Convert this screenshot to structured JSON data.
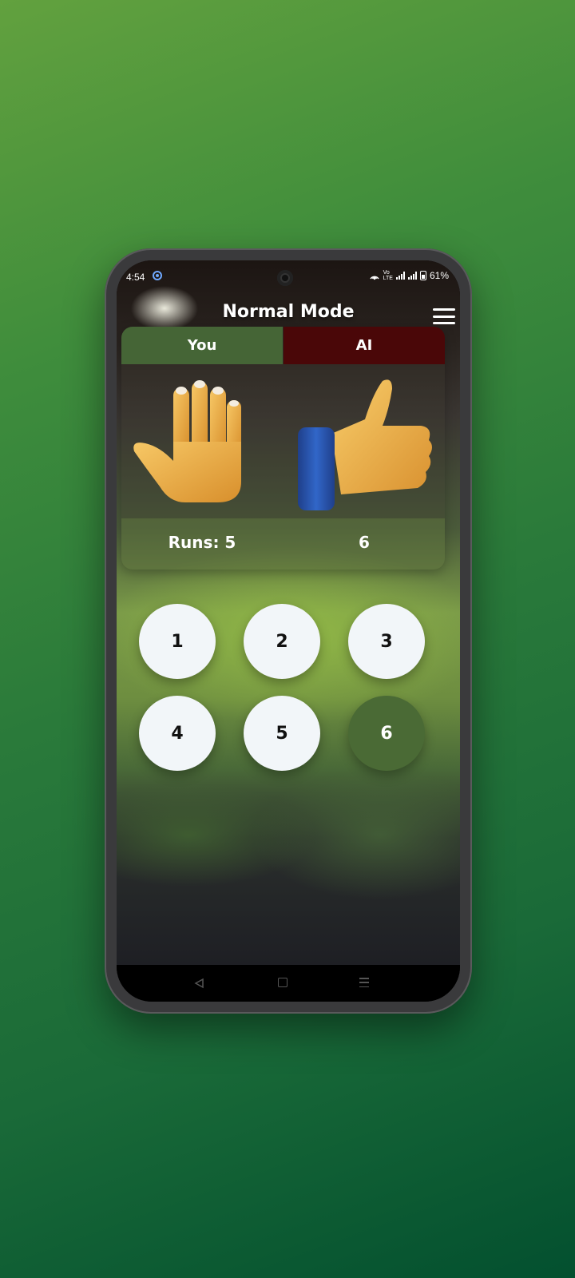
{
  "status": {
    "time": "4:54",
    "volte_top": "Vo",
    "volte_bottom": "LTE",
    "battery": "61%"
  },
  "header": {
    "title": "Normal Mode"
  },
  "scoreboard": {
    "you_label": "You",
    "ai_label": "AI",
    "you_score": "Runs: 5",
    "ai_score": "6",
    "you_hand_icon": "raised-hand-icon",
    "ai_hand_icon": "thumbs-up-icon"
  },
  "number_buttons": [
    "1",
    "2",
    "3",
    "4",
    "5",
    "6"
  ],
  "selected_number": "6",
  "colors": {
    "you_tab": "#456536",
    "ai_tab": "#4a0708",
    "button_bg": "#f2f6f9",
    "button_active": "#4a6a35",
    "page_bg_start": "#62a13e",
    "page_bg_end": "#03502f"
  }
}
